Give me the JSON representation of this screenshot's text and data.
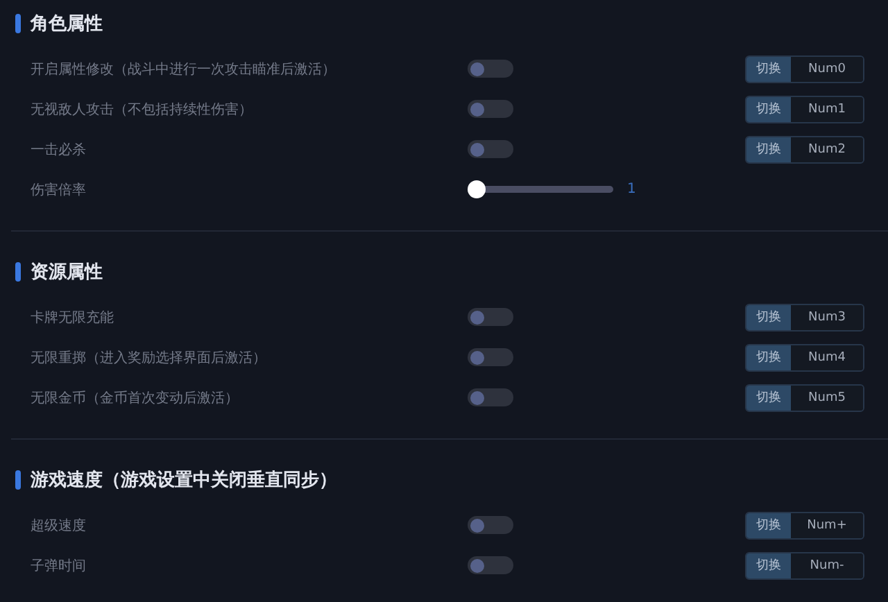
{
  "sections": [
    {
      "title": "角色属性",
      "rows": [
        {
          "kind": "toggle",
          "label": "开启属性修改（战斗中进行一次攻击瞄准后激活）",
          "on": false,
          "action": "切换",
          "hotkey": "Num0"
        },
        {
          "kind": "toggle",
          "label": "无视敌人攻击（不包括持续性伤害）",
          "on": false,
          "action": "切换",
          "hotkey": "Num1"
        },
        {
          "kind": "toggle",
          "label": "一击必杀",
          "on": false,
          "action": "切换",
          "hotkey": "Num2"
        },
        {
          "kind": "slider",
          "label": "伤害倍率",
          "level": 0,
          "reading": "1"
        }
      ]
    },
    {
      "title": "资源属性",
      "rows": [
        {
          "kind": "toggle",
          "label": "卡牌无限充能",
          "on": false,
          "action": "切换",
          "hotkey": "Num3"
        },
        {
          "kind": "toggle",
          "label": "无限重掷（进入奖励选择界面后激活）",
          "on": false,
          "action": "切换",
          "hotkey": "Num4"
        },
        {
          "kind": "toggle",
          "label": "无限金币（金币首次变动后激活）",
          "on": false,
          "action": "切换",
          "hotkey": "Num5"
        }
      ]
    },
    {
      "title": "游戏速度（游戏设置中关闭垂直同步）",
      "rows": [
        {
          "kind": "toggle",
          "label": "超级速度",
          "on": false,
          "action": "切换",
          "hotkey": "Num+"
        },
        {
          "kind": "toggle",
          "label": "子弹时间",
          "on": false,
          "action": "切换",
          "hotkey": "Num-"
        }
      ]
    }
  ]
}
